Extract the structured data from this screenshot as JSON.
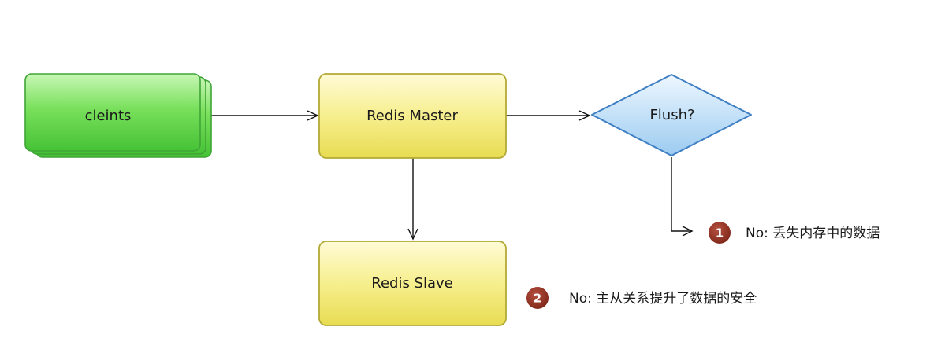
{
  "nodes": {
    "clients": {
      "label": "cleints"
    },
    "master": {
      "label": "Redis Master"
    },
    "slave": {
      "label": "Redis Slave"
    },
    "flush": {
      "label": "Flush?"
    }
  },
  "notes": [
    {
      "number": "1",
      "text": "No: 丢失内存中的数据"
    },
    {
      "number": "2",
      "text": "No: 主从关系提升了数据的安全"
    }
  ],
  "colors": {
    "clients_fill": "#5fd34a",
    "clients_border": "#3fa536",
    "master_fill": "#f1ea7a",
    "master_border": "#b3a935",
    "flush_fill": "#b9dbf6",
    "flush_border": "#3f7fc4",
    "badge": "#8e3125",
    "edge": "#111111"
  }
}
